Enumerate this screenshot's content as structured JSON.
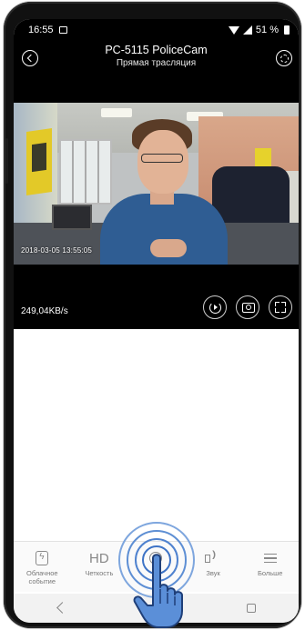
{
  "status_bar": {
    "time": "16:55",
    "battery": "51 %",
    "icons": [
      "image-notification-icon",
      "wifi-icon",
      "signal-icon",
      "battery-icon"
    ]
  },
  "header": {
    "title": "PC-5115 PoliceCam",
    "subtitle": "Прямая трасляция",
    "icons": [
      "back-icon",
      "settings-icon"
    ]
  },
  "video": {
    "timestamp": "2018-03-05 13:55:05",
    "bitrate": "249,04KB/s",
    "controls": [
      "replay-icon",
      "snapshot-icon",
      "fullscreen-icon"
    ]
  },
  "toolbar": {
    "items": [
      {
        "label": "Облачное\nсобытие",
        "icon": "cloud-event-icon"
      },
      {
        "label": "Четкость",
        "icon_text": "HD",
        "icon": "hd-icon"
      },
      {
        "label": "",
        "icon": "record-icon"
      },
      {
        "label": "Звук",
        "icon": "sound-icon"
      },
      {
        "label": "Больше",
        "icon": "menu-icon"
      }
    ]
  },
  "overlay": {
    "icon": "tap-hand-icon"
  },
  "navbar": {
    "icons": [
      "nav-back-icon",
      "nav-home-icon",
      "nav-recent-icon"
    ]
  },
  "colors": {
    "screen_bg": "#000000",
    "tap_blue": "#4f82cf",
    "toolbar_text": "#777777"
  }
}
